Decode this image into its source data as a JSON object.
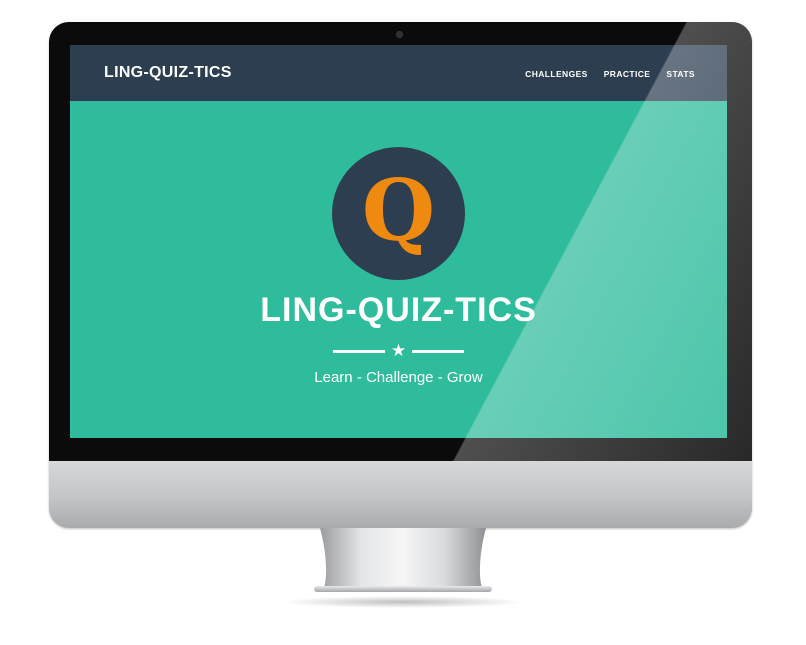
{
  "navbar": {
    "brand": "LING-QUIZ-TICS",
    "links": [
      "CHALLENGES",
      "PRACTICE",
      "STATS"
    ]
  },
  "hero": {
    "logo_letter": "Q",
    "title": "LING-QUIZ-TICS",
    "divider_icon": "star-icon",
    "tagline": "Learn - Challenge - Grow"
  },
  "colors": {
    "accent_teal": "#2fbc9c",
    "navy": "#2d3e50",
    "logo_orange": "#ee8a10"
  }
}
